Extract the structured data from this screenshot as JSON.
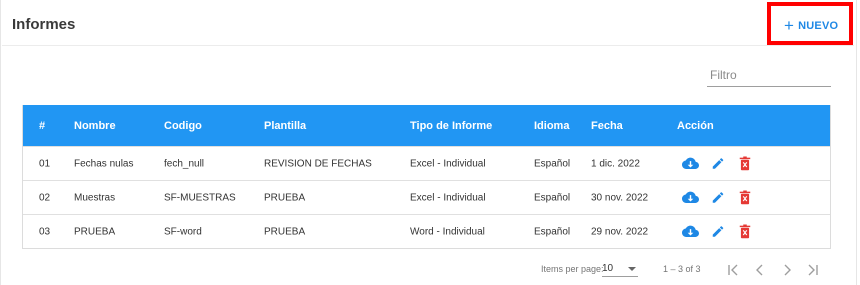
{
  "page": {
    "title": "Informes"
  },
  "toolbar": {
    "new_label": "NUEVO",
    "new_icon": "plus-icon"
  },
  "filter": {
    "placeholder": "Filtro",
    "value": ""
  },
  "colors": {
    "accent": "#2196f3",
    "download": "#1e88e5",
    "edit": "#1e88e5",
    "delete": "#e53935",
    "highlight": "#ff0000"
  },
  "table": {
    "columns": [
      "#",
      "Nombre",
      "Codigo",
      "Plantilla",
      "Tipo de Informe",
      "Idioma",
      "Fecha",
      "Acción"
    ],
    "rows": [
      {
        "num": "01",
        "nombre": "Fechas nulas",
        "codigo": "fech_null",
        "plantilla": "REVISION DE FECHAS",
        "tipo": "Excel - Individual",
        "idioma": "Español",
        "fecha": "1 dic. 2022"
      },
      {
        "num": "02",
        "nombre": "Muestras",
        "codigo": "SF-MUESTRAS",
        "plantilla": "PRUEBA",
        "tipo": "Excel - Individual",
        "idioma": "Español",
        "fecha": "30 nov. 2022"
      },
      {
        "num": "03",
        "nombre": "PRUEBA",
        "codigo": "SF-word",
        "plantilla": "PRUEBA",
        "tipo": "Word - Individual",
        "idioma": "Español",
        "fecha": "29 nov. 2022"
      }
    ],
    "action_icons": [
      "cloud-download-icon",
      "pencil-edit-icon",
      "trash-delete-icon"
    ]
  },
  "paginator": {
    "items_per_page_label": "Items per page:",
    "page_size": "10",
    "range_label": "1 – 3 of 3"
  }
}
